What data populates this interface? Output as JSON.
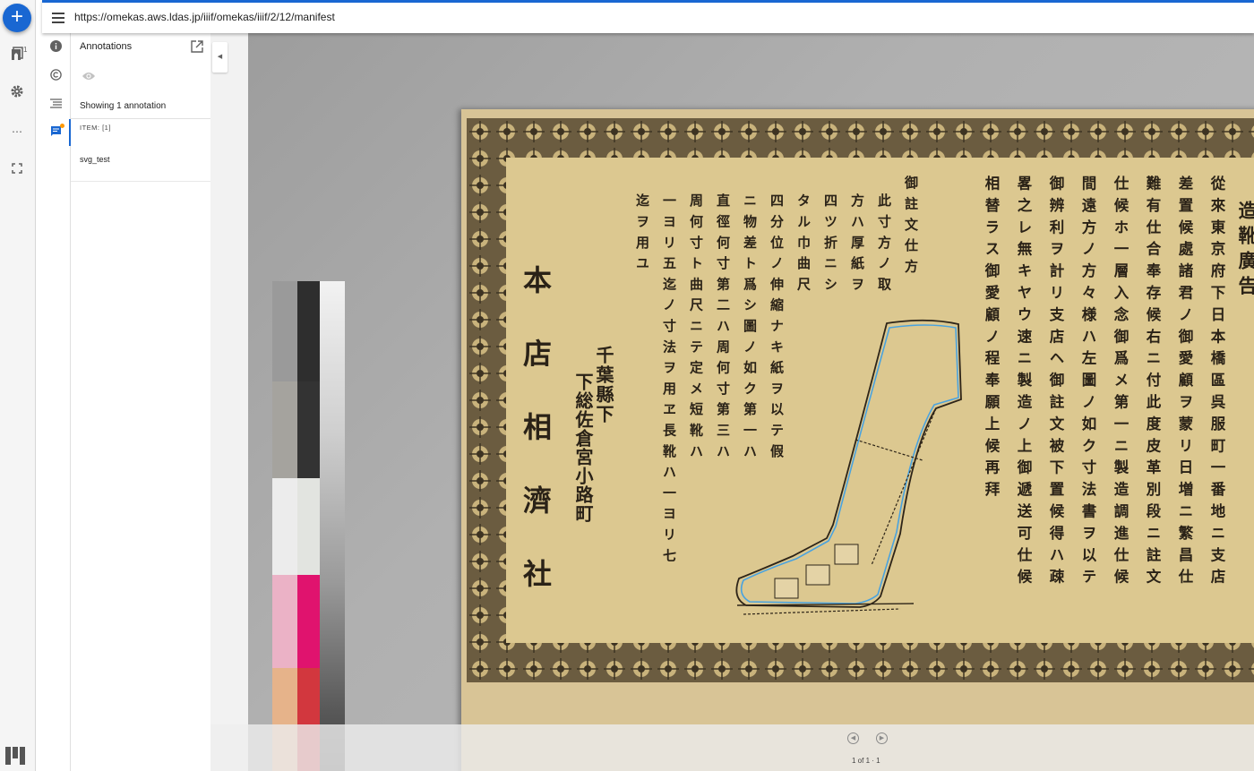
{
  "toolbar": {
    "url": "https://omekas.aws.ldas.jp/iiif/omekas/iiif/2/12/manifest"
  },
  "rail": {
    "add_icon": "plus-icon",
    "manifests_badge": "1",
    "items": [
      "manifest-list-icon",
      "settings-icon",
      "more-icon",
      "fullscreen-icon"
    ]
  },
  "companion": {
    "icons": [
      "info-icon",
      "rights-icon",
      "toc-icon",
      "annotations-icon"
    ]
  },
  "annotations": {
    "title": "Annotations",
    "showing": "Showing 1 annotation",
    "item_label": "ITEM: [1]",
    "items": [
      "svg_test"
    ]
  },
  "document": {
    "heading": "造靴廣告",
    "shop_name": "本店相濟社",
    "prefecture": "千葉縣下",
    "address": "下総佐倉宮小路町",
    "body_columns": [
      "從來東京府下日本橋區呉服町一番地ニ支店",
      "差置候處諸君ノ御愛顧ヲ蒙リ日増ニ繁昌仕",
      "難有仕合奉存候右ニ付此度皮革別段ニ註文",
      "仕候ホ一層入念御爲メ第一ニ製造調進仕候",
      "間遠方ノ方々様ハ左圖ノ如ク寸法書ヲ以テ",
      "御辨利ヲ計リ支店ヘ御註文被下置候得ハ疎",
      "畧之レ無キヤウ速ニ製造ノ上御遞送可仕候",
      "相替ラス御愛顧ノ程奉願上候再拜"
    ],
    "instruction_columns": [
      "御註文仕方",
      "此寸方ノ取",
      "方ハ厚紙ヲ",
      "四ツ折ニシ",
      "タル巾曲尺",
      "四分位ノ伸縮ナキ紙ヲ以テ假",
      "ニ物差ト爲シ圖ノ如ク第一ハ",
      "直徑何寸第二ハ周何寸第三ハ",
      "周何寸ト曲尺ニテ定メ短靴ハ",
      "一ヨリ五迄ノ寸法ヲ用ヱ長靴ハ一ヨリ七",
      "迄ヲ用ユ"
    ]
  },
  "viewer": {
    "page_indicator": "1 of 1 · 1",
    "prev_icon": "previous-page-icon",
    "next_icon": "next-page-icon"
  },
  "colors": {
    "accent": "#1967d2",
    "badge": "#ff9800",
    "annotation_stroke": "#4aa3df"
  }
}
